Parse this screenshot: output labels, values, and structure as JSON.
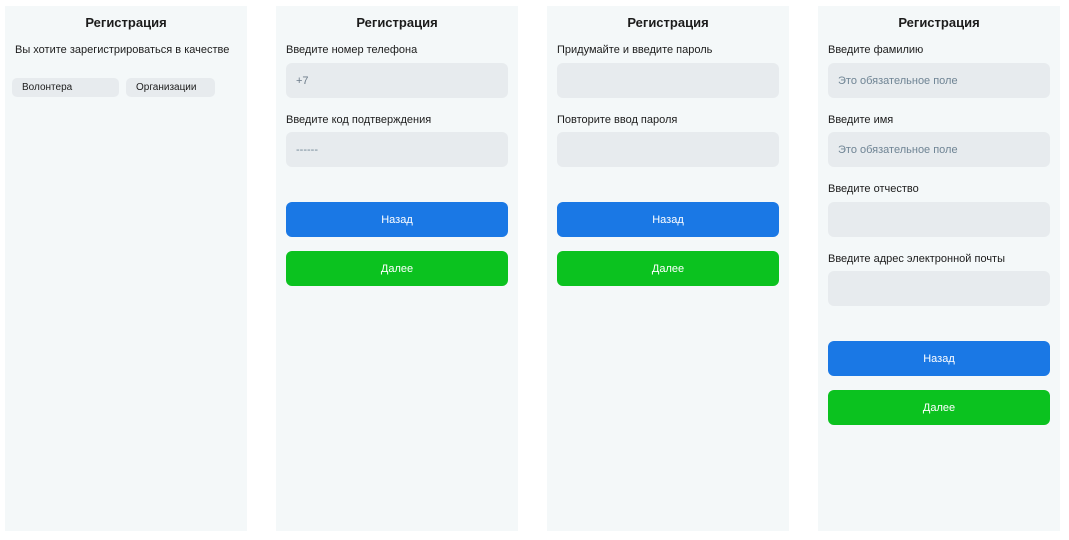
{
  "screen1": {
    "title": "Регистрация",
    "question": "Вы хотите зарегистрироваться в качестве",
    "options": [
      "Волонтера",
      "Организации"
    ]
  },
  "screen2": {
    "title": "Регистрация",
    "phone_label": "Введите номер телефона",
    "phone_value": "+7",
    "code_label": "Введите код подтверждения",
    "code_placeholder": "------",
    "back_label": "Назад",
    "next_label": "Далее"
  },
  "screen3": {
    "title": "Регистрация",
    "password_label": "Придумайте и введите пароль",
    "repeat_label": "Повторите ввод пароля",
    "back_label": "Назад",
    "next_label": "Далее"
  },
  "screen4": {
    "title": "Регистрация",
    "surname_label": "Введите фамилию",
    "surname_placeholder": "Это обязательное поле",
    "name_label": "Введите имя",
    "name_placeholder": "Это обязательное поле",
    "patronymic_label": "Введите отчество",
    "email_label": "Введите адрес электронной почты",
    "back_label": "Назад",
    "next_label": "Далее"
  },
  "colors": {
    "panel_bg": "#f4f8f9",
    "field_bg": "#e7ebee",
    "back_button": "#1a78e5",
    "next_button": "#0bc21f"
  }
}
